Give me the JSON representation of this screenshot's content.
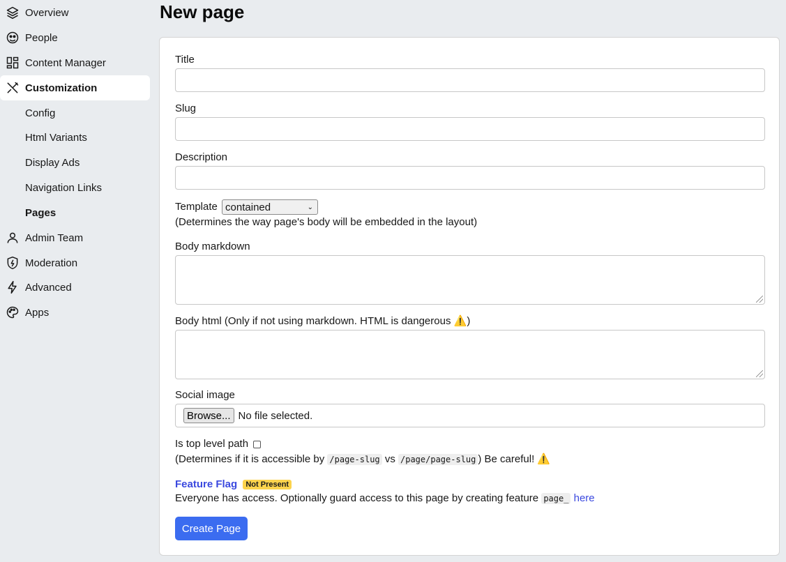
{
  "sidebar": {
    "items": [
      {
        "label": "Overview",
        "icon": "layers-icon"
      },
      {
        "label": "People",
        "icon": "people-icon"
      },
      {
        "label": "Content Manager",
        "icon": "dashboard-icon"
      },
      {
        "label": "Customization",
        "icon": "tools-icon"
      }
    ],
    "sub_items": [
      {
        "label": "Config"
      },
      {
        "label": "Html Variants"
      },
      {
        "label": "Display Ads"
      },
      {
        "label": "Navigation Links"
      },
      {
        "label": "Pages"
      }
    ],
    "items_after": [
      {
        "label": "Admin Team",
        "icon": "user-icon"
      },
      {
        "label": "Moderation",
        "icon": "shield-bolt-icon"
      },
      {
        "label": "Advanced",
        "icon": "bolt-icon"
      },
      {
        "label": "Apps",
        "icon": "palette-icon"
      }
    ]
  },
  "page": {
    "title": "New page"
  },
  "form": {
    "title_label": "Title",
    "title_value": "",
    "slug_label": "Slug",
    "slug_value": "",
    "description_label": "Description",
    "description_value": "",
    "template_label": "Template",
    "template_selected": "contained",
    "template_hint": "(Determines the way page's body will be embedded in the layout)",
    "body_markdown_label": "Body markdown",
    "body_html_label": "Body html (Only if not using markdown. HTML is dangerous",
    "warning_emoji": "⚠️",
    "body_html_label_close": ")",
    "social_image_label": "Social image",
    "browse_label": "Browse...",
    "no_file_label": "No file selected.",
    "top_level_label": "Is top level path",
    "top_level_hint_pre": "(Determines if it is accessible by",
    "top_level_code_1": "/page-slug",
    "top_level_hint_mid": "vs",
    "top_level_code_2": "/page/page-slug",
    "top_level_hint_post": ") Be careful!",
    "feature_flag_title": "Feature Flag",
    "feature_flag_badge": "Not Present",
    "feature_flag_text": "Everyone has access. Optionally guard access to this page by creating feature",
    "feature_flag_code": "page_",
    "feature_flag_link": "here",
    "submit_label": "Create Page"
  },
  "colors": {
    "background": "#e9ecef",
    "primary": "#3b6cf0",
    "link": "#3b49df",
    "badge": "#fcd34d"
  }
}
